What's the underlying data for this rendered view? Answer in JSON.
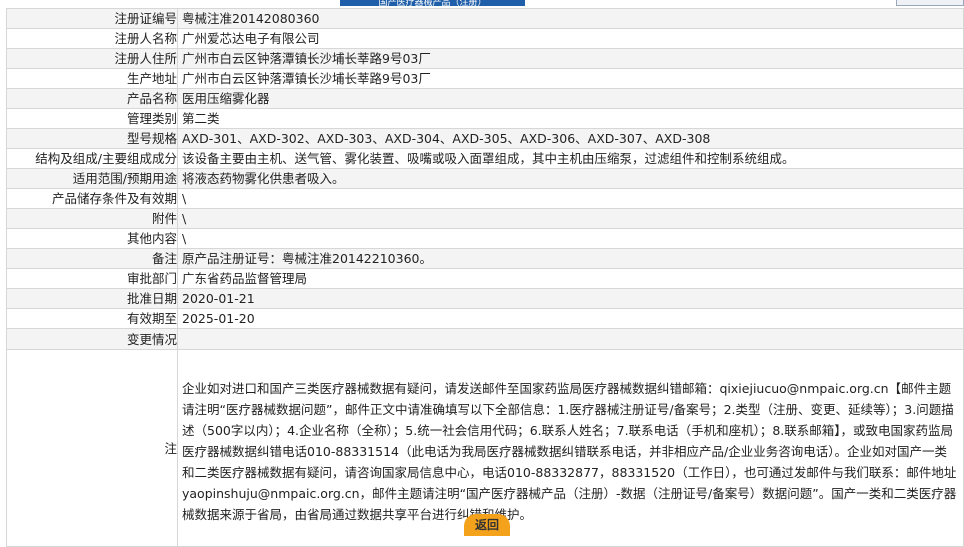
{
  "header": {
    "banner_title": "国产医疗器械产品（注册）"
  },
  "rows": [
    {
      "label": "注册证编号",
      "value": "粤械注准20142080360"
    },
    {
      "label": "注册人名称",
      "value": "广州爱芯达电子有限公司"
    },
    {
      "label": "注册人住所",
      "value": "广州市白云区钟落潭镇长沙埔长莘路9号03厂"
    },
    {
      "label": "生产地址",
      "value": "广州市白云区钟落潭镇长沙埔长莘路9号03厂"
    },
    {
      "label": "产品名称",
      "value": "医用压缩雾化器"
    },
    {
      "label": "管理类别",
      "value": "第二类"
    },
    {
      "label": "型号规格",
      "value": "AXD-301、AXD-302、AXD-303、AXD-304、AXD-305、AXD-306、AXD-307、AXD-308"
    },
    {
      "label": "结构及组成/主要组成成分",
      "value": "该设备主要由主机、送气管、雾化装置、吸嘴或吸入面罩组成，其中主机由压缩泵，过滤组件和控制系统组成。"
    },
    {
      "label": "适用范围/预期用途",
      "value": "将液态药物雾化供患者吸入。"
    },
    {
      "label": "产品储存条件及有效期",
      "value": "\\"
    },
    {
      "label": "附件",
      "value": "\\"
    },
    {
      "label": "其他内容",
      "value": "\\"
    },
    {
      "label": "备注",
      "value": "原产品注册证号：粤械注准20142210360。"
    },
    {
      "label": "审批部门",
      "value": "广东省药品监督管理局"
    },
    {
      "label": "批准日期",
      "value": "2020-01-21"
    },
    {
      "label": "有效期至",
      "value": "2025-01-20"
    },
    {
      "label": "变更情况",
      "value": ""
    }
  ],
  "note": {
    "label": "注",
    "text": "企业如对进口和国产三类医疗器械数据有疑问，请发送邮件至国家药监局医疗器械数据纠错邮箱：qixiejiucuo@nmpaic.org.cn【邮件主题请注明“医疗器械数据问题”，邮件正文中请准确填写以下全部信息：1.医疗器械注册证号/备案号；2.类型（注册、变更、延续等）；3.问题描述（500字以内）；4.企业名称（全称）；5.统一社会信用代码；6.联系人姓名；7.联系电话（手机和座机）；8.联系邮箱】，或致电国家药监局医疗器械数据纠错电话010-88331514（此电话为我局医疗器械数据纠错联系电话，并非相应产品/企业业务咨询电话）。企业如对国产一类和二类医疗器械数据有疑问，请咨询国家局信息中心，电话010-88332877，88331520（工作日），也可通过发邮件与我们联系：邮件地址yaopinshuju@nmpaic.org.cn，邮件主题请注明“国产医疗器械产品（注册）-数据（注册证号/备案号）数据问题”。国产一类和二类医疗器械数据来源于省局，由省局通过数据共享平台进行纠错和维护。"
  },
  "footer": {
    "back_label": "返回"
  }
}
